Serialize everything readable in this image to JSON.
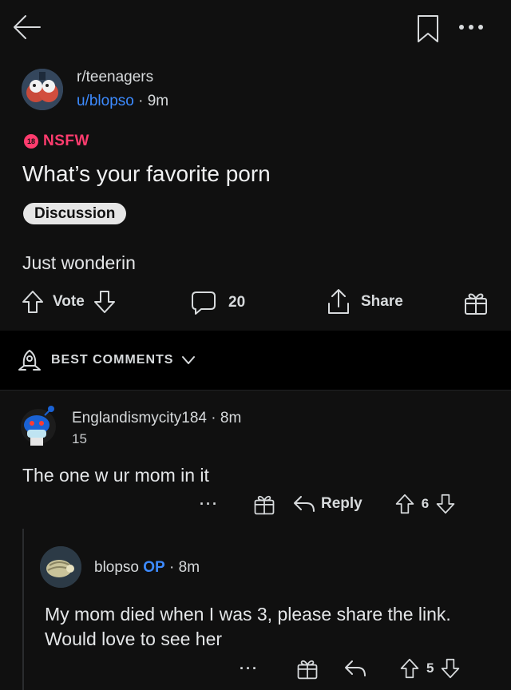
{
  "topbar": {
    "back_icon": "arrow-left-icon",
    "bookmark_icon": "bookmark-icon",
    "more_icon": "more-horizontal-icon"
  },
  "post": {
    "subreddit": "r/teenagers",
    "author": "u/blopso",
    "separator": "·",
    "age": "9m",
    "nsfw_badge": "18",
    "nsfw_label": "NSFW",
    "title": "What’s your favorite porn",
    "flair": "Discussion",
    "body": "Just wonderin",
    "vote_label": "Vote",
    "comment_count": "20",
    "share_label": "Share"
  },
  "sort": {
    "label": "BEST COMMENTS"
  },
  "comments": [
    {
      "author": "Englandismycity184",
      "separator": "·",
      "age": "8m",
      "score_line": "15",
      "text": "The one w ur mom in it",
      "more": "···",
      "reply_label": "Reply",
      "votes": "6"
    },
    {
      "author": "blopso",
      "op_tag": "OP",
      "separator": "·",
      "age": "8m",
      "text": "My mom died when I was 3, please share the link. Would love to see her",
      "more": "···",
      "votes": "5"
    }
  ],
  "colors": {
    "background": "#101010",
    "nsfw": "#ff3c6e",
    "link_blue": "#3d8bff",
    "text": "#e4e6e8"
  }
}
